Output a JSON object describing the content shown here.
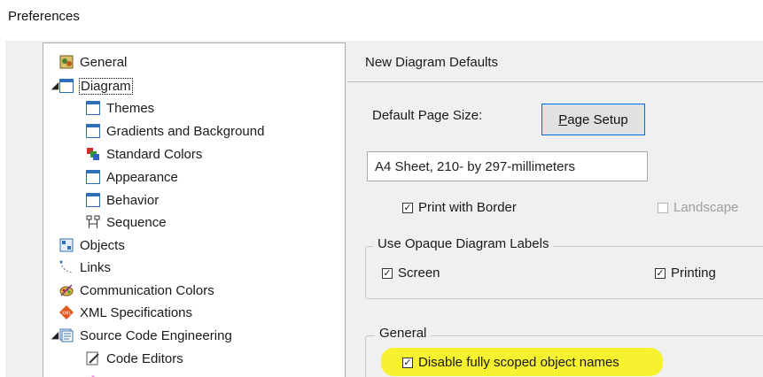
{
  "window": {
    "title": "Preferences"
  },
  "tree": {
    "items": [
      {
        "label": "General",
        "icon": "general-icon"
      },
      {
        "label": "Diagram",
        "icon": "diagram-page-icon"
      },
      {
        "label": "Themes",
        "icon": "page-icon"
      },
      {
        "label": "Gradients and Background",
        "icon": "page-icon"
      },
      {
        "label": "Standard Colors",
        "icon": "color-palette-icon"
      },
      {
        "label": "Appearance",
        "icon": "page-icon"
      },
      {
        "label": "Behavior",
        "icon": "page-icon"
      },
      {
        "label": "Sequence",
        "icon": "sequence-icon"
      },
      {
        "label": "Objects",
        "icon": "objects-icon"
      },
      {
        "label": "Links",
        "icon": "links-icon"
      },
      {
        "label": "Communication Colors",
        "icon": "communication-colors-icon"
      },
      {
        "label": "XML Specifications",
        "icon": "xml-icon"
      },
      {
        "label": "Source Code Engineering",
        "icon": "source-code-icon"
      },
      {
        "label": "Code Editors",
        "icon": "code-editor-icon"
      }
    ]
  },
  "panel": {
    "heading": "New Diagram Defaults",
    "page_size_label": "Default Page Size:",
    "page_setup_button": "Page Setup",
    "page_size_value": "A4 Sheet, 210- by 297-millimeters",
    "print_with_border": {
      "label": "Print with Border",
      "checked": true
    },
    "landscape": {
      "label": "Landscape",
      "checked": false,
      "disabled": true
    },
    "opaque_group": {
      "legend": "Use Opaque Diagram Labels",
      "screen": {
        "label": "Screen",
        "checked": true
      },
      "printing": {
        "label": "Printing",
        "checked": true
      }
    },
    "general_group": {
      "legend": "General",
      "disable_scoped": {
        "label": "Disable fully scoped object names",
        "checked": true
      }
    }
  },
  "colors": {
    "accent": "#0a6ad1",
    "highlight": "#f7f230",
    "tree_icon_blue": "#2f6fb8"
  }
}
